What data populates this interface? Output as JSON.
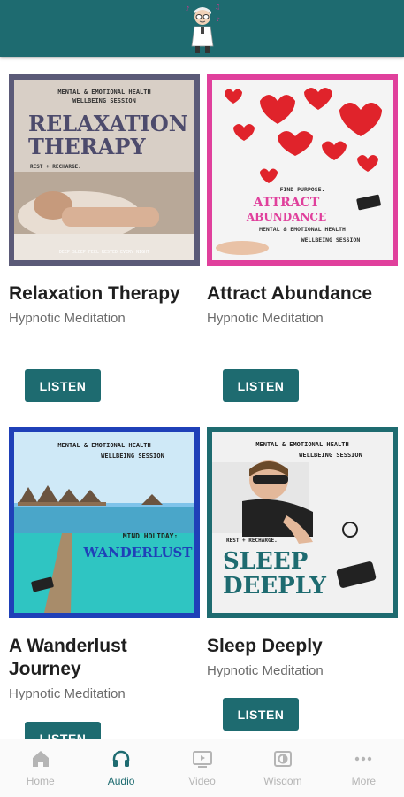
{
  "header": {
    "logo": "cartoon-doctor-mascot"
  },
  "cards": [
    {
      "title": "Relaxation Therapy",
      "subtitle": "Hypnotic Meditation",
      "button": "LISTEN",
      "cover": {
        "top_line1": "MENTAL & EMOTIONAL HEALTH",
        "top_line2": "WELLBEING SESSION",
        "headline1": "RELAXATION",
        "headline2": "THERAPY",
        "tagline": "REST + RECHARGE.",
        "footer": "DEEP SLEEP FEEL RESTED EVERY NIGHT",
        "frame_color": "#5b5a78"
      }
    },
    {
      "title": "Attract Abundance",
      "subtitle": "Hypnotic Meditation",
      "button": "LISTEN",
      "cover": {
        "kicker": "FIND PURPOSE.",
        "headline1": "ATTRACT",
        "headline2": "ABUNDANCE",
        "bottom_line1": "MENTAL & EMOTIONAL HEALTH",
        "bottom_line2": "WELLBEING SESSION",
        "frame_color": "#e0409c"
      }
    },
    {
      "title": "A Wanderlust Journey",
      "subtitle": "Hypnotic Meditation",
      "button": "LISTEN",
      "cover": {
        "top_line1": "MENTAL & EMOTIONAL HEALTH",
        "top_line2": "WELLBEING SESSION",
        "kicker": "MIND HOLIDAY:",
        "headline1": "WANDERLUST",
        "frame_color": "#1f40b8"
      }
    },
    {
      "title": "Sleep Deeply",
      "subtitle": "Hypnotic Meditation",
      "button": "LISTEN",
      "cover": {
        "top_line1": "MENTAL & EMOTIONAL HEALTH",
        "top_line2": "WELLBEING SESSION",
        "tagline": "REST + RECHARGE.",
        "headline1": "SLEEP",
        "headline2": "DEEPLY",
        "frame_color": "#1e6b70"
      }
    }
  ],
  "tabs": [
    {
      "label": "Home",
      "icon": "home-icon",
      "active": false
    },
    {
      "label": "Audio",
      "icon": "headphones-icon",
      "active": true
    },
    {
      "label": "Video",
      "icon": "video-icon",
      "active": false
    },
    {
      "label": "Wisdom",
      "icon": "wisdom-icon",
      "active": false
    },
    {
      "label": "More",
      "icon": "more-icon",
      "active": false
    }
  ],
  "colors": {
    "brand": "#1e6b70",
    "tab_inactive": "#b5b5b5"
  }
}
